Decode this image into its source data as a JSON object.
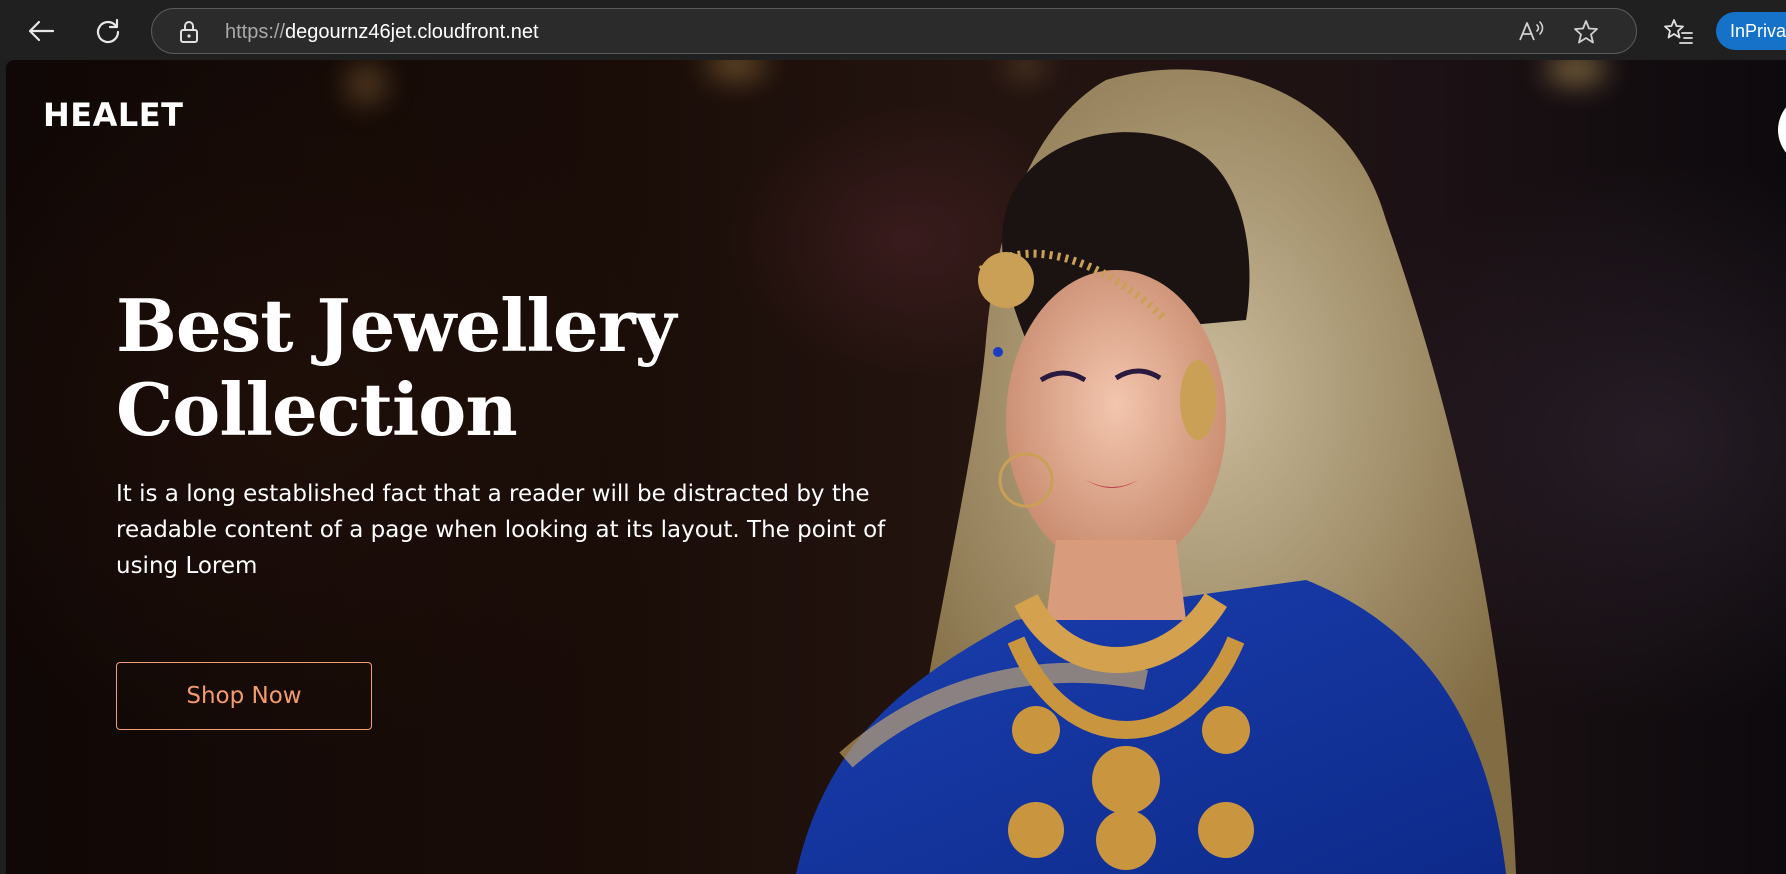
{
  "browser": {
    "url_scheme": "https://",
    "url_host": "degournz46jet.cloudfront.net",
    "inprivate_label": "InPrivate",
    "icons": [
      "back-icon",
      "refresh-icon",
      "lock-icon",
      "read-aloud-icon",
      "favorite-star-icon",
      "favorites-list-icon"
    ]
  },
  "site": {
    "logo": "HEALET",
    "hero": {
      "headline_line1": "Best Jewellery",
      "headline_line2": "Collection",
      "description": "It is a long established fact that a reader will be distracted by the readable content of a page when looking at its layout. The point of using Lorem",
      "cta_label": "Shop Now",
      "image": "bride-in-jewellery-photo"
    }
  },
  "colors": {
    "accent": "#f39b6d",
    "inprivate": "#1672c9",
    "toolbar": "#202020"
  }
}
